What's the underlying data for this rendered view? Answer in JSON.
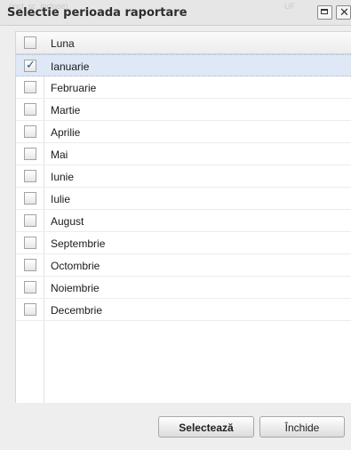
{
  "dialog": {
    "title": "Selectie perioada raportare",
    "ghost_left": "(incl. sc. incluse)",
    "ghost_right": "UF"
  },
  "grid": {
    "column_header": "Luna",
    "rows": [
      {
        "label": "Ianuarie",
        "checked": true
      },
      {
        "label": "Februarie",
        "checked": false
      },
      {
        "label": "Martie",
        "checked": false
      },
      {
        "label": "Aprilie",
        "checked": false
      },
      {
        "label": "Mai",
        "checked": false
      },
      {
        "label": "Iunie",
        "checked": false
      },
      {
        "label": "Iulie",
        "checked": false
      },
      {
        "label": "August",
        "checked": false
      },
      {
        "label": "Septembrie",
        "checked": false
      },
      {
        "label": "Octombrie",
        "checked": false
      },
      {
        "label": "Noiembrie",
        "checked": false
      },
      {
        "label": "Decembrie",
        "checked": false
      }
    ]
  },
  "buttons": {
    "select_label": "Selectează",
    "close_label": "Închide"
  },
  "icons": {
    "maximize": "maximize-icon",
    "close": "close-icon",
    "checkmark": "checkmark-icon"
  },
  "colors": {
    "selected_row": "#dfe8f6",
    "check_mark": "#2a4f98"
  }
}
